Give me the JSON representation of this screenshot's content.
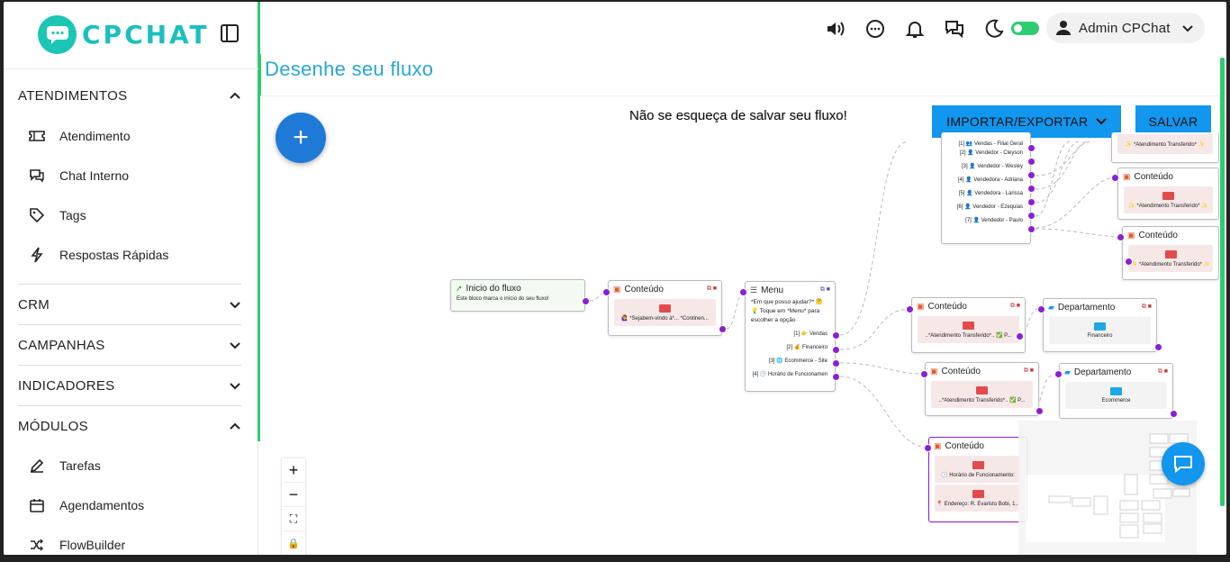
{
  "app": {
    "brand": "CPCHAT"
  },
  "sidebar": {
    "sections": [
      {
        "label": "ATENDIMENTOS",
        "expanded": true
      },
      {
        "label": "CRM",
        "expanded": false
      },
      {
        "label": "CAMPANHAS",
        "expanded": false
      },
      {
        "label": "INDICADORES",
        "expanded": false
      },
      {
        "label": "MÓDULOS",
        "expanded": true
      }
    ],
    "items": [
      {
        "label": "Atendimento",
        "icon": "ticket-icon"
      },
      {
        "label": "Chat Interno",
        "icon": "chat-bubbles-icon"
      },
      {
        "label": "Tags",
        "icon": "tag-icon"
      },
      {
        "label": "Respostas Rápidas",
        "icon": "bolt-icon"
      },
      {
        "label": "Tarefas",
        "icon": "pencil-icon"
      },
      {
        "label": "Agendamentos",
        "icon": "calendar-icon"
      },
      {
        "label": "FlowBuilder",
        "icon": "shuffle-icon"
      }
    ]
  },
  "header": {
    "user": "Admin CPChat",
    "accent": "#2ecc71"
  },
  "page": {
    "title": "Desenhe seu fluxo"
  },
  "canvas": {
    "notice": "Não se esqueça de salvar seu fluxo!",
    "import_export": "IMPORTAR/EXPORTAR",
    "save": "SALVAR",
    "controls": [
      "+",
      "−",
      "⛶",
      "🔒"
    ]
  },
  "flow": {
    "start": {
      "title": "Inicio do fluxo",
      "text": "Este bloco marca o início do seu fluxo!"
    },
    "content1": {
      "title": "Conteúdo",
      "text": "🙋‍♀️ *Sejabem-vindo à*... *Continen..."
    },
    "menu": {
      "title": "Menu",
      "text": "*Em que posso ajudar?* 🤔💡 Toque em *Menu* para escolher a opção",
      "options": [
        "[1] 👉 Vendas",
        "[2] 💰 Financeiro",
        "[3] 🌐 Ecommerce - Site",
        "[4] 🕒 Horário de Funcionamen"
      ]
    },
    "content2": {
      "title": "Conteúdo",
      "text": "..*Atendimento Transferido*.. ✅ P..."
    },
    "content3": {
      "title": "Conteúdo",
      "text": "..*Atendimento Transferido*.. ✅ P..."
    },
    "content4": {
      "title": "Conteúdo",
      "text1": "🕒 Horário de Funcionamento:",
      "text2": "📍 Endereço: R. Evaristo Bobi, 1..."
    },
    "dept1": {
      "title": "Departamento",
      "text": "Financeiro"
    },
    "dept2": {
      "title": "Departamento",
      "text": "Ecommerce"
    },
    "sellers": [
      "[1] 👥 Vendas - Filial Geral",
      "[2] 👤 Vendedor - Cleyson",
      "[3] 👤 Vendedor - Wesley",
      "[4] 👤 Vendedora - Adriana",
      "[5] 👤 Vendedora - Larissa",
      "[6] 👤 Vendedor - Ezequias",
      "[7] 👤 Vendedor - Paulo"
    ],
    "right_contents": [
      {
        "title": "",
        "text": "✨ *Atendimento Transferido* ✨"
      },
      {
        "title": "Conteúdo",
        "text": "✨ *Atendimento Transferido* ✨"
      },
      {
        "title": "Conteúdo",
        "text": "✨ *Atendimento Transferido* ✨"
      }
    ]
  }
}
